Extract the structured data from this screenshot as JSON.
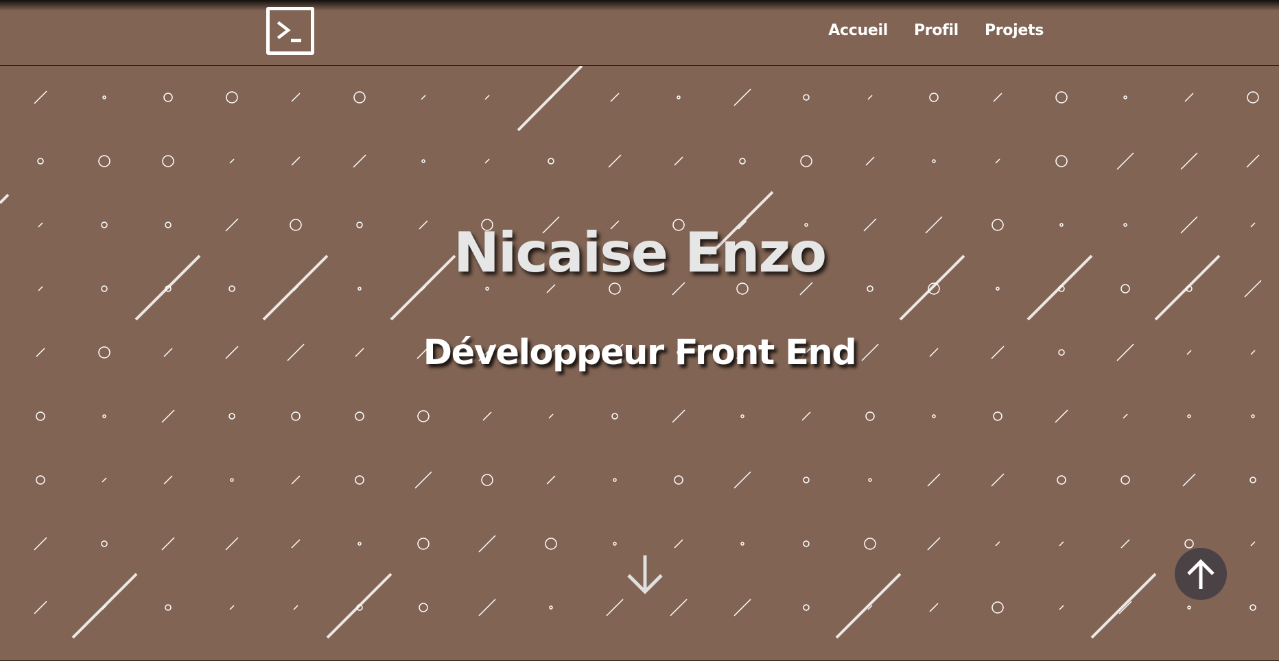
{
  "header": {
    "logo_icon": "terminal-icon",
    "nav": [
      {
        "label": "Accueil"
      },
      {
        "label": "Profil"
      },
      {
        "label": "Projets"
      }
    ]
  },
  "hero": {
    "title": "Nicaise Enzo",
    "subtitle": "Développeur Front End"
  },
  "controls": {
    "scroll_down_icon": "arrow-down-icon",
    "back_to_top_icon": "arrow-up-icon"
  },
  "colors": {
    "background": "#816454",
    "pattern": "#ffffff",
    "back_to_top_bg": "#4b4246"
  }
}
